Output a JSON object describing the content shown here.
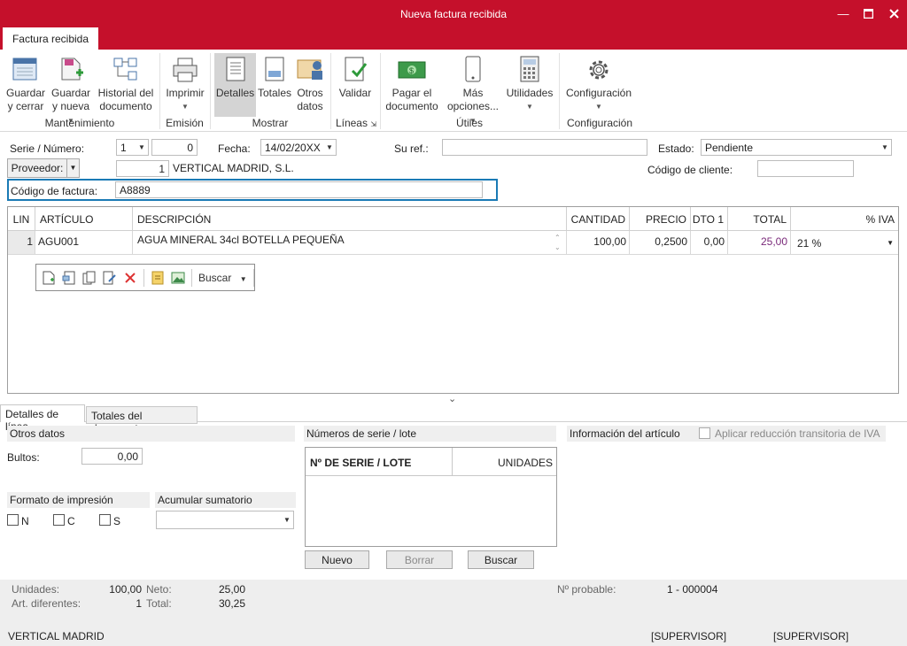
{
  "window": {
    "title": "Nueva factura recibida",
    "minimize_icon": "minimize-icon",
    "maximize_icon": "maximize-icon",
    "close_icon": "close-icon"
  },
  "ribbon": {
    "tab": "Factura recibida",
    "buttons": [
      {
        "l1": "Guardar",
        "l2": "y cerrar",
        "icon": "save-close-icon"
      },
      {
        "l1": "Guardar",
        "l2": "y nueva",
        "icon": "save-new-icon"
      },
      {
        "l1": "Historial del",
        "l2": "documento",
        "icon": "history-icon"
      },
      {
        "l1": "Imprimir",
        "l2": "",
        "icon": "printer-icon"
      },
      {
        "l1": "Detalles",
        "l2": "",
        "icon": "details-icon"
      },
      {
        "l1": "Totales",
        "l2": "",
        "icon": "totals-icon"
      },
      {
        "l1": "Otros",
        "l2": "datos",
        "icon": "other-data-icon"
      },
      {
        "l1": "Validar",
        "l2": "",
        "icon": "validate-icon"
      },
      {
        "l1": "Pagar el",
        "l2": "documento",
        "icon": "pay-icon"
      },
      {
        "l1": "Más",
        "l2": "opciones...",
        "icon": "mobile-icon"
      },
      {
        "l1": "Utilidades",
        "l2": "",
        "icon": "calculator-icon"
      },
      {
        "l1": "Configuración",
        "l2": "",
        "icon": "gear-icon"
      }
    ],
    "groups": [
      "Mantenimiento",
      "Emisión",
      "Mostrar",
      "Líneas",
      "Útiles",
      "Configuración"
    ]
  },
  "form": {
    "serie_label": "Serie / Número:",
    "serie_value": "1",
    "numero_value": "0",
    "fecha_label": "Fecha:",
    "fecha_value": "14/02/20XX",
    "suref_label": "Su ref.:",
    "suref_value": "",
    "estado_label": "Estado:",
    "estado_value": "Pendiente",
    "proveedor_label": "Proveedor:",
    "proveedor_code": "1",
    "proveedor_name": "VERTICAL MADRID, S.L.",
    "codigo_cliente_label": "Código de cliente:",
    "codigo_cliente_value": "",
    "codigo_factura_label": "Código de factura:",
    "codigo_factura_value": "A8889"
  },
  "grid": {
    "headers": [
      "LIN",
      "ARTÍCULO",
      "DESCRIPCIÓN",
      "CANTIDAD",
      "PRECIO",
      "DTO 1",
      "TOTAL",
      "% IVA"
    ],
    "rows": [
      {
        "lin": "1",
        "articulo": "AGU001",
        "descripcion": "AGUA MINERAL 34cl BOTELLA PEQUEÑA",
        "cantidad": "100,00",
        "precio": "0,2500",
        "dto": "0,00",
        "total": "25,00",
        "iva": "21 %"
      }
    ],
    "toolbar_search": "Buscar"
  },
  "bottom_tabs": [
    "Detalles de línea",
    "Totales del documento"
  ],
  "detalles": {
    "otros_datos": "Otros datos",
    "bultos_label": "Bultos:",
    "bultos_value": "0,00",
    "formato_label": "Formato de impresión",
    "acumular_label": "Acumular sumatorio",
    "chk_n": "N",
    "chk_c": "C",
    "chk_s": "S",
    "series_label": "Números de serie / lote",
    "series_col1": "Nº DE SERIE / LOTE",
    "series_col2": "UNIDADES",
    "btn_nuevo": "Nuevo",
    "btn_borrar": "Borrar",
    "btn_buscar": "Buscar",
    "info_label": "Información del artículo",
    "reduccion_label": "Aplicar reducción transitoria de IVA"
  },
  "footer": {
    "unidades_label": "Unidades:",
    "unidades_value": "100,00",
    "art_label": "Art. diferentes:",
    "art_value": "1",
    "neto_label": "Neto:",
    "neto_value": "25,00",
    "total_label": "Total:",
    "total_value": "30,25",
    "probable_label": "Nº probable:",
    "probable_value": "1 - 000004",
    "company": "VERTICAL MADRID",
    "user1": "[SUPERVISOR]",
    "user2": "[SUPERVISOR]"
  },
  "colors": {
    "accent": "#c5102b",
    "highlight": "#1a7ab5",
    "total": "#7a2a7a"
  }
}
